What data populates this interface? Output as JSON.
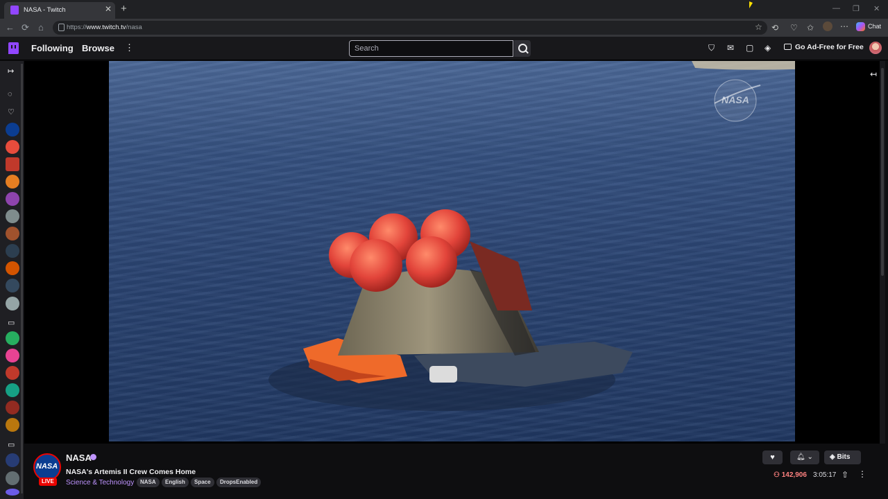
{
  "browser": {
    "tab_title": "NASA - Twitch",
    "url_prefix": "https://",
    "url_domain": "www.twitch.tv",
    "url_path": "/nasa",
    "chat_label": "Chat"
  },
  "topnav": {
    "following": "Following",
    "browse": "Browse",
    "search_placeholder": "Search",
    "ad_free": "Go Ad-Free for Free"
  },
  "video": {
    "watermark": "NASA"
  },
  "channel": {
    "name": "NASA",
    "avatar_text": "NASA",
    "live_badge": "LIVE",
    "stream_title": "NASA's Artemis II Crew Comes Home",
    "category": "Science & Technology",
    "tags": [
      "NASA",
      "English",
      "Space",
      "DropsEnabled"
    ],
    "bits_label": "Bits",
    "viewers": "142,906",
    "uptime": "3:05:17"
  },
  "colors": {
    "twitch_purple": "#9146ff",
    "live_red": "#eb0400",
    "viewer_red": "#ff8280",
    "category_purple": "#bf94ff"
  }
}
